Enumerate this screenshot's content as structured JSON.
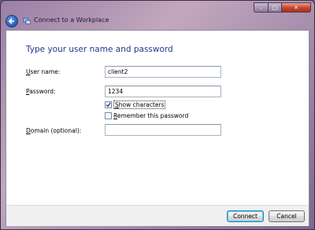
{
  "window": {
    "title": "Connect to a Workplace",
    "controls": {
      "minimize": "–",
      "maximize": "□",
      "close": "✕"
    }
  },
  "dialog": {
    "heading": "Type your user name and password",
    "username": {
      "accel": "U",
      "label_rest": "ser name:",
      "value": "client2"
    },
    "password": {
      "accel": "P",
      "label_rest": "assword:",
      "value": "1234"
    },
    "show_characters": {
      "accel": "S",
      "label_rest": "how characters",
      "checked": true
    },
    "remember_password": {
      "accel": "R",
      "label_rest": "emember this password",
      "checked": false
    },
    "domain": {
      "accel": "D",
      "label_rest": "omain (optional):",
      "value": ""
    }
  },
  "buttons": {
    "connect": "Connect",
    "cancel": "Cancel"
  },
  "colors": {
    "heading": "#1e3a8a",
    "accent": "#2a62c4",
    "close": "#c4452c"
  },
  "icons": {
    "back": "back-arrow-icon",
    "app": "network-connection-icon"
  }
}
